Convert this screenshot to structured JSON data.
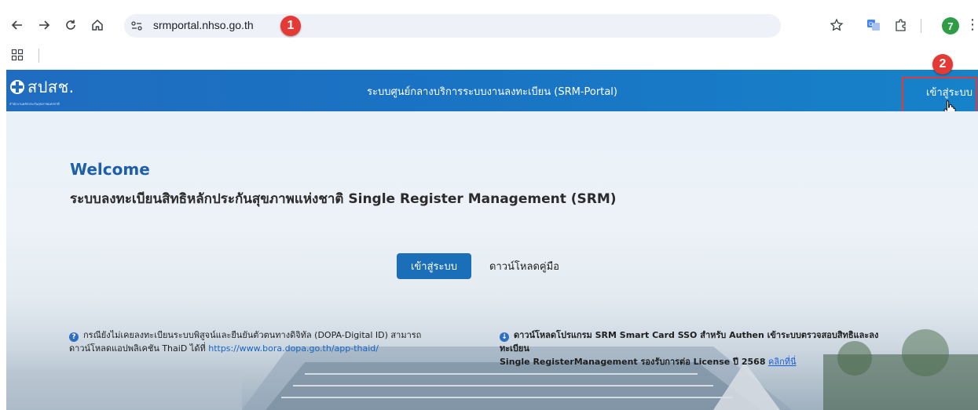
{
  "browser": {
    "url": "srmportal.nhso.go.th",
    "profile_initial": "7",
    "icons": [
      "back-arrow-icon",
      "forward-arrow-icon",
      "reload-icon",
      "home-icon",
      "site-settings-icon",
      "star-icon",
      "translate-icon",
      "extensions-icon",
      "profile-avatar",
      "more-menu-icon",
      "apps-grid-icon"
    ]
  },
  "markers": {
    "one": "1",
    "two": "2"
  },
  "header": {
    "logo_text": "สปสช.",
    "logo_sub": "สำนักงานหลักประกันสุขภาพแห่งชาติ",
    "title": "ระบบศูนย์กลางบริการระบบงานลงทะเบียน (SRM-Portal)",
    "login_label": "เข้าสู่ระบบ"
  },
  "main": {
    "welcome": "Welcome",
    "subtitle": "ระบบลงทะเบียนสิทธิหลักประกันสุขภาพแห่งชาติ Single Register Management (SRM)",
    "login_button": "เข้าสู่ระบบ",
    "manual_button": "ดาวน์โหลดคู่มือ"
  },
  "notes": {
    "left_icon": "?",
    "left_line1": "กรณียังไม่เคยลงทะเบียนระบบพิสูจน์และยืนยันตัวตนทางดิจิทัล (DOPA-Digital ID) สามารถ",
    "left_line2": "ดาวน์โหลดแอปพลิเคชัน ThaiD ได้ที่",
    "left_link": "https://www.bora.dopa.go.th/app-thaid/",
    "right_icon": "↓",
    "right_line1": "ดาวน์โหลดโปรแกรม SRM Smart Card SSO สำหรับ Authen เข้าระบบตรวจสอบสิทธิและลง",
    "right_line2": "ทะเบียน",
    "right_line3": "Single RegisterManagement รองรับการต่อ License ปี 2568",
    "right_link": "คลิกที่นี่"
  },
  "colors": {
    "header_blue": "#1a73c4",
    "accent_button": "#1a6fb8",
    "welcome_blue": "#1d5fa8",
    "marker_red": "#e53935"
  }
}
